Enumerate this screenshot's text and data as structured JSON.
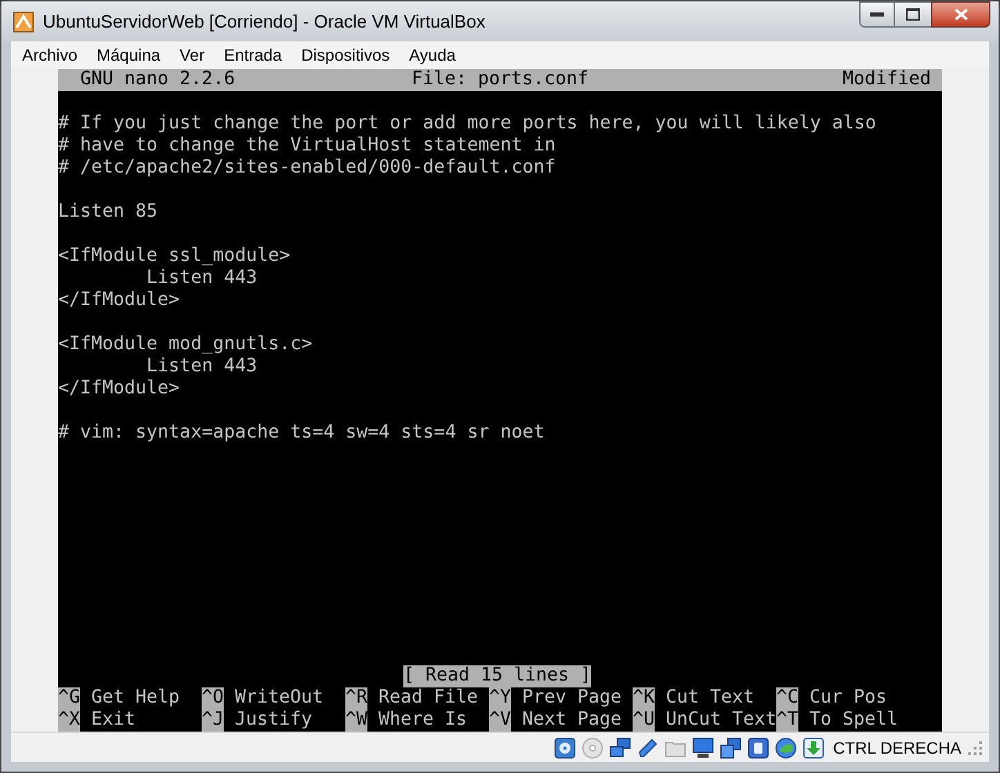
{
  "window": {
    "title": "UbuntuServidorWeb [Corriendo] - Oracle VM VirtualBox"
  },
  "menu": [
    "Archivo",
    "Máquina",
    "Ver",
    "Entrada",
    "Dispositivos",
    "Ayuda"
  ],
  "nano": {
    "version": "GNU nano 2.2.6",
    "file": "File: ports.conf",
    "state": "Modified",
    "blocks": [
      [
        "# If you just change the port or add more ports here, you will likely also",
        "# have to change the VirtualHost statement in",
        "# /etc/apache2/sites-enabled/000-default.conf"
      ],
      [
        "Listen 85"
      ],
      [
        "<IfModule ssl_module>",
        "        Listen 443",
        "</IfModule>"
      ],
      [
        "<IfModule mod_gnutls.c>",
        "        Listen 443",
        "</IfModule>"
      ],
      [
        "# vim: syntax=apache ts=4 sw=4 sts=4 sr noet"
      ]
    ],
    "message": "[ Read 15 lines ]",
    "shortcuts": [
      [
        {
          "key": "^G",
          "label": "Get Help"
        },
        {
          "key": "^O",
          "label": "WriteOut"
        },
        {
          "key": "^R",
          "label": "Read File"
        },
        {
          "key": "^Y",
          "label": "Prev Page"
        },
        {
          "key": "^K",
          "label": "Cut Text"
        },
        {
          "key": "^C",
          "label": "Cur Pos"
        }
      ],
      [
        {
          "key": "^X",
          "label": "Exit"
        },
        {
          "key": "^J",
          "label": "Justify"
        },
        {
          "key": "^W",
          "label": "Where Is"
        },
        {
          "key": "^V",
          "label": "Next Page"
        },
        {
          "key": "^U",
          "label": "UnCut Text"
        },
        {
          "key": "^T",
          "label": "To Spell"
        }
      ]
    ]
  },
  "status_bar": {
    "host_key": "CTRL DERECHA"
  }
}
